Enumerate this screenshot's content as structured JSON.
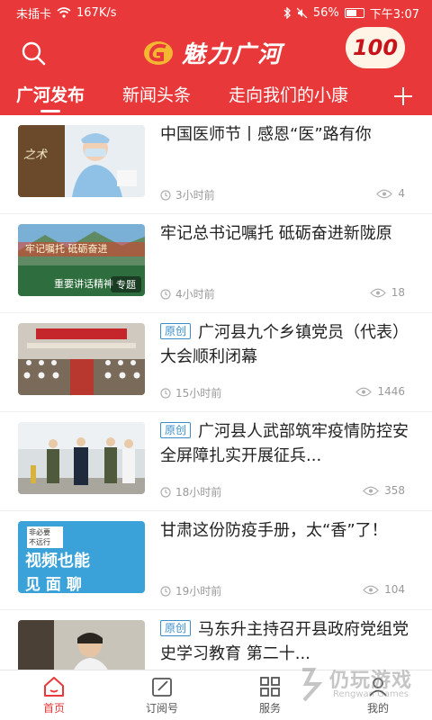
{
  "statusbar": {
    "sim": "未插卡",
    "speed": "167K/s",
    "battery": "56%",
    "time": "下午3:07"
  },
  "header": {
    "title": "魅力广河",
    "badge_number": "100"
  },
  "tabs": [
    {
      "label": "广河发布",
      "active": true
    },
    {
      "label": "新闻头条",
      "active": false
    },
    {
      "label": "走向我们的小康",
      "active": false
    }
  ],
  "tab_add": "+",
  "news": [
    {
      "title": "中国医师节丨感恩“医”路有你",
      "original_tag": "",
      "thumb_tag": "",
      "time": "3小时前",
      "views": "4"
    },
    {
      "title": "牢记总书记嘱托  砥砺奋进新陇原",
      "original_tag": "",
      "thumb_tag": "专题",
      "time": "4小时前",
      "views": "18"
    },
    {
      "title": "广河县九个乡镇党员（代表）大会顺利闭幕",
      "original_tag": "原创",
      "thumb_tag": "",
      "time": "15小时前",
      "views": "1446"
    },
    {
      "title": "广河县人武部筑牢疫情防控安全屏障扎实开展征兵...",
      "original_tag": "原创",
      "thumb_tag": "",
      "time": "18小时前",
      "views": "358"
    },
    {
      "title": "甘肃这份防疫手册，太“香”了！",
      "original_tag": "",
      "thumb_tag": "",
      "time": "19小时前",
      "views": "104"
    },
    {
      "title": "马东升主持召开县政府党组党史学习教育 第二十...",
      "original_tag": "原创",
      "thumb_tag": "",
      "time": "",
      "views": ""
    }
  ],
  "thumb_texts": {
    "n1_left": "之术",
    "n2_top": "牢记嘱托 砥砺奋进",
    "n2_mid": "重要讲话精神",
    "n5_small": "非必要",
    "n5_small2": "不远行",
    "n5_big": "视频也能",
    "n5_bottom": "见 面 聊"
  },
  "bottom_nav": [
    {
      "label": "首页",
      "icon": "home-icon",
      "active": true
    },
    {
      "label": "订阅号",
      "icon": "edit-icon",
      "active": false
    },
    {
      "label": "服务",
      "icon": "grid-icon",
      "active": false
    },
    {
      "label": "我的",
      "icon": "user-icon",
      "active": false
    }
  ],
  "watermark": {
    "main": "仍玩游戏",
    "sub": "Rengwan Games"
  },
  "colors": {
    "brand_red": "#e8383a",
    "tag_blue": "#3b8ec9"
  }
}
